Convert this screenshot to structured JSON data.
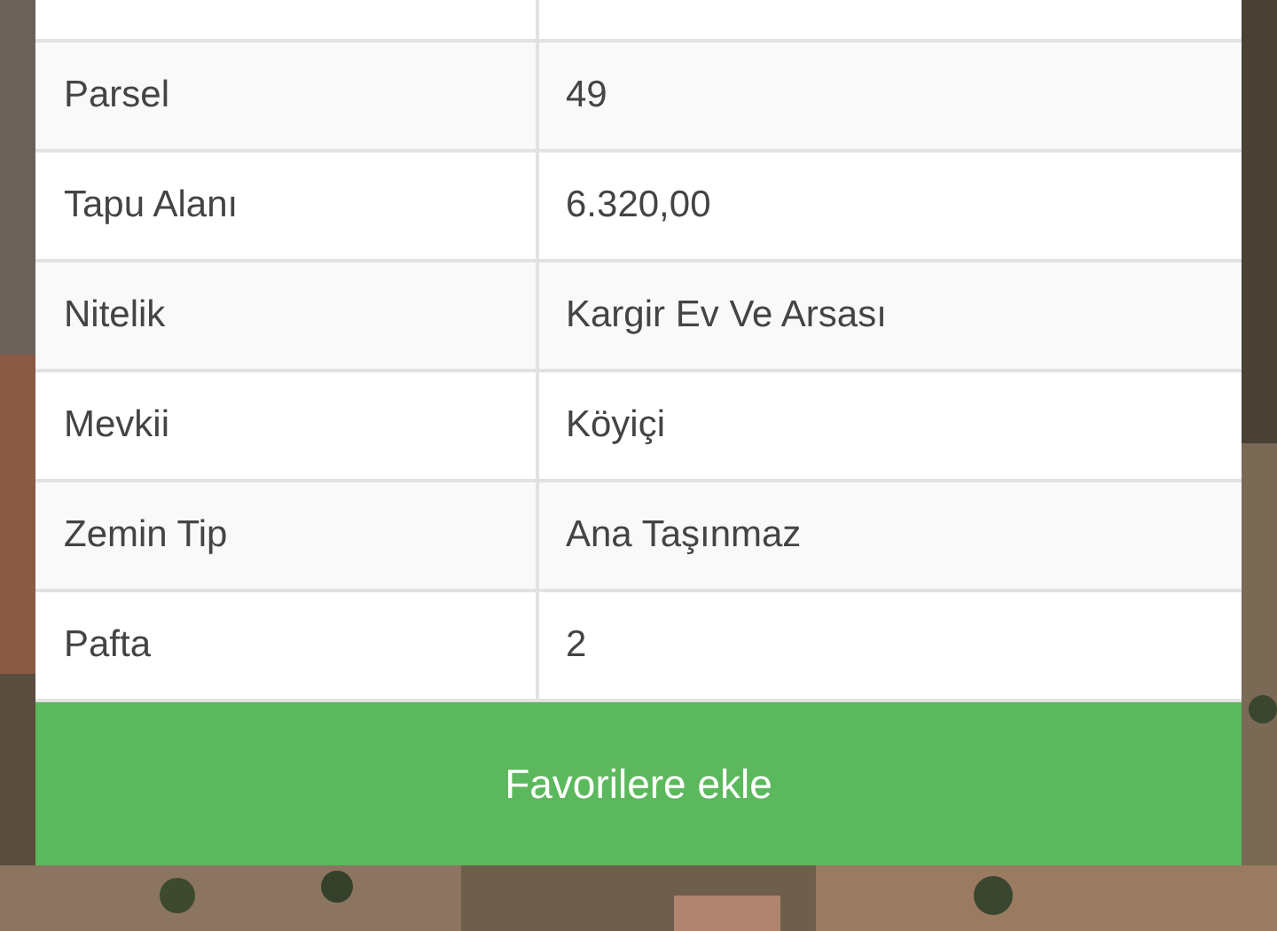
{
  "table": {
    "rows": [
      {
        "label": "Parsel",
        "value": "49"
      },
      {
        "label": "Tapu Alanı",
        "value": "6.320,00"
      },
      {
        "label": "Nitelik",
        "value": "Kargir Ev Ve Arsası"
      },
      {
        "label": "Mevkii",
        "value": "Köyiçi"
      },
      {
        "label": "Zemin Tip",
        "value": "Ana Taşınmaz"
      },
      {
        "label": "Pafta",
        "value": "2"
      }
    ]
  },
  "button": {
    "label": "Favorilere ekle"
  }
}
